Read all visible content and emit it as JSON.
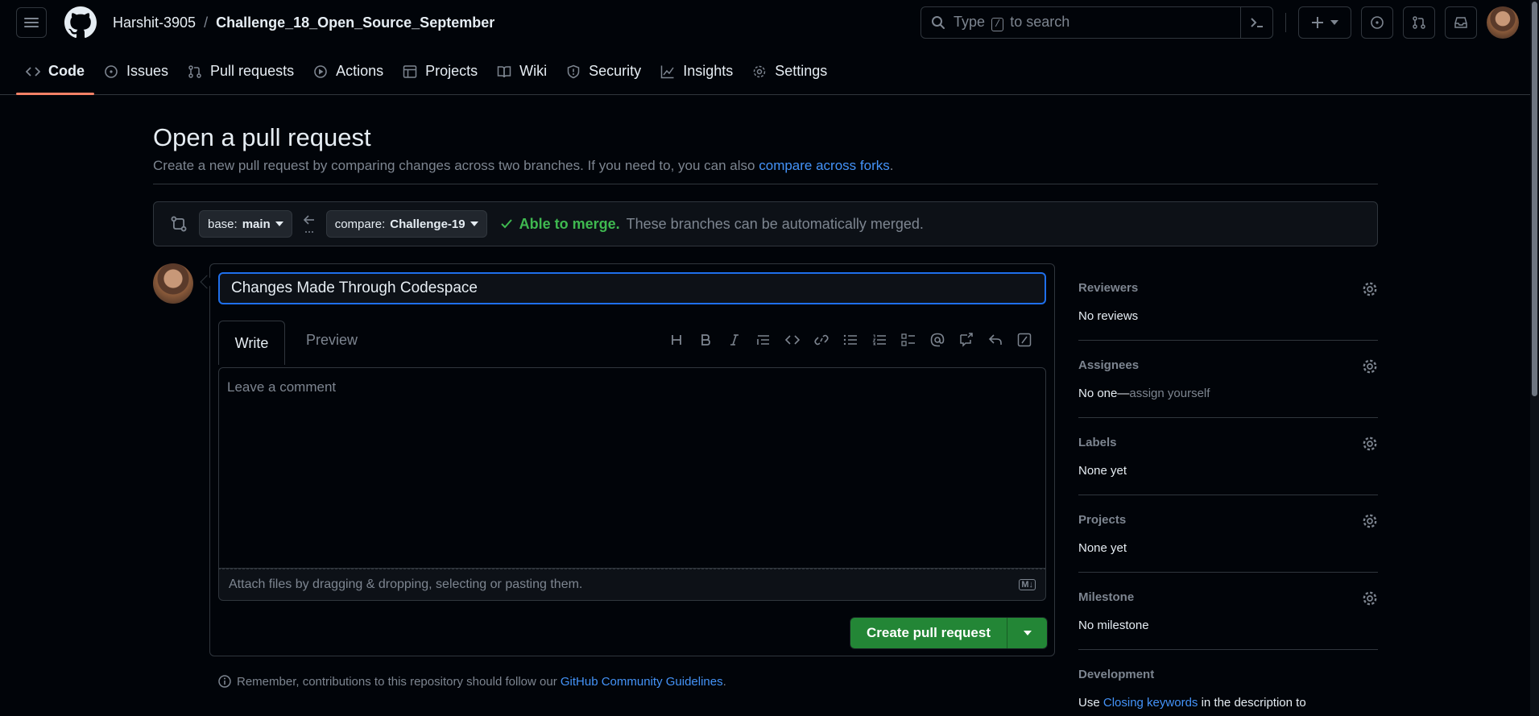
{
  "header": {
    "owner": "Harshit-3905",
    "separator": "/",
    "repo": "Challenge_18_Open_Source_September",
    "search_before": "Type",
    "search_key": "/",
    "search_after": "to search"
  },
  "nav": {
    "items": [
      {
        "label": "Code",
        "icon": "code-icon"
      },
      {
        "label": "Issues",
        "icon": "issue-icon"
      },
      {
        "label": "Pull requests",
        "icon": "pull-request-icon"
      },
      {
        "label": "Actions",
        "icon": "play-icon"
      },
      {
        "label": "Projects",
        "icon": "table-icon"
      },
      {
        "label": "Wiki",
        "icon": "book-icon"
      },
      {
        "label": "Security",
        "icon": "shield-icon"
      },
      {
        "label": "Insights",
        "icon": "graph-icon"
      },
      {
        "label": "Settings",
        "icon": "gear-icon"
      }
    ],
    "active": "Code"
  },
  "main": {
    "title": "Open a pull request",
    "subtitle": "Create a new pull request by comparing changes across two branches. If you need to, you can also",
    "subtitle_link": "compare across forks",
    "subtitle_end": ".",
    "base_prefix": "base:",
    "base_branch": "main",
    "compare_prefix": "compare:",
    "compare_branch": "Challenge-19",
    "merge_ok": "Able to merge.",
    "merge_msg": "These branches can be automatically merged."
  },
  "form": {
    "title_value": "Changes Made Through Codespace",
    "tab_write": "Write",
    "tab_preview": "Preview",
    "comment_placeholder": "Leave a comment",
    "attach_text": "Attach files by dragging & dropping, selecting or pasting them.",
    "markdown_badge": "M↓",
    "submit_label": "Create pull request",
    "reminder": "Remember, contributions to this repository should follow our",
    "reminder_link": "GitHub Community Guidelines",
    "reminder_end": "."
  },
  "sidebar": {
    "reviewers": {
      "heading": "Reviewers",
      "value": "No reviews"
    },
    "assignees": {
      "heading": "Assignees",
      "value": "No one—",
      "link": "assign yourself"
    },
    "labels": {
      "heading": "Labels",
      "value": "None yet"
    },
    "projects": {
      "heading": "Projects",
      "value": "None yet"
    },
    "milestone": {
      "heading": "Milestone",
      "value": "No milestone"
    },
    "development": {
      "heading": "Development",
      "before": "Use",
      "link": "Closing keywords",
      "after": "in the description to"
    }
  },
  "colors": {
    "accent": "#4493f8",
    "success": "#3fb950",
    "button": "#238636",
    "tab_underline": "#f78166"
  }
}
